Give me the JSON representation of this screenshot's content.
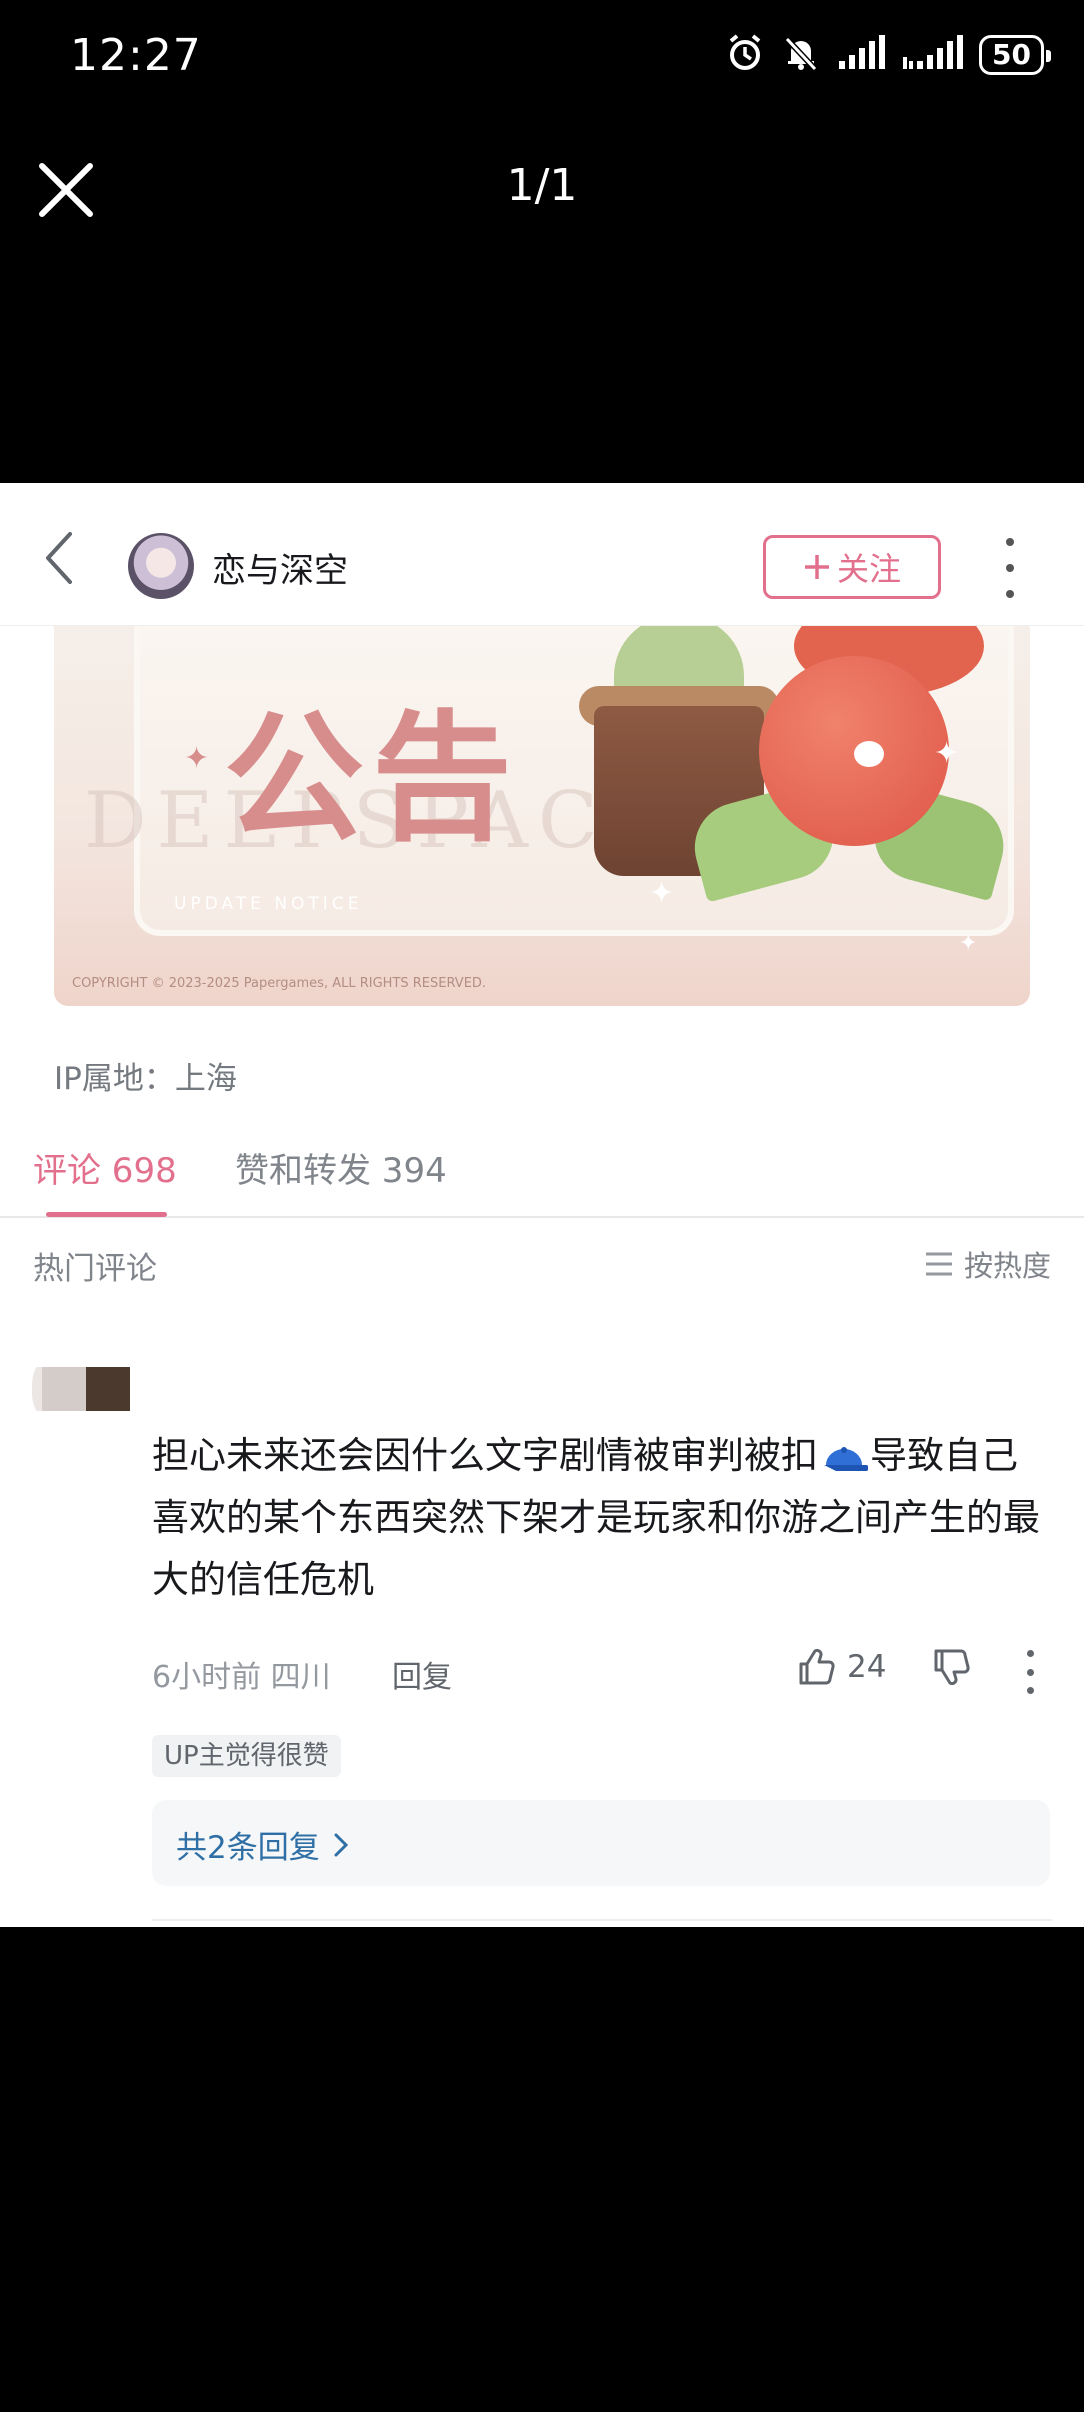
{
  "status_bar": {
    "time": "12:27",
    "battery": "50",
    "icons": [
      "alarm-icon",
      "bell-muted-icon",
      "signal-icon",
      "signal-icon"
    ]
  },
  "viewer": {
    "counter": "1/1",
    "close_icon": "close-icon"
  },
  "post_header": {
    "author_name": "恋与深空",
    "follow_label": "关注",
    "follow_icon": "plus-icon",
    "back_icon": "chevron-left-icon",
    "more_icon": "more-vertical-icon"
  },
  "banner": {
    "title": "公告",
    "watermark": "DEEPSPACE",
    "notice": "UPDATE NOTICE",
    "copyright": "COPYRIGHT © 2023-2025 Papergames, ALL RIGHTS RESERVED."
  },
  "post": {
    "ip_location": "IP属地：上海"
  },
  "tabs": [
    {
      "label": "评论 698",
      "active": true
    },
    {
      "label": "赞和转发 394",
      "active": false
    }
  ],
  "comments_section": {
    "hot_label": "热门评论",
    "sort_label": "按热度",
    "sort_icon": "list-icon"
  },
  "comment": {
    "text_part1": "担心未来还会因什么文字剧情被审判被扣",
    "emoji": "cap-emoji",
    "text_part2": "导致自己喜欢的某个东西突然下架才是玩家和你游之间产生的最大的信任危机",
    "time_location": "6小时前 四川",
    "reply_label": "回复",
    "like_count": "24",
    "up_badge": "UP主觉得很赞",
    "replies_label": "共2条回复"
  },
  "colors": {
    "accent": "#e2708d",
    "link": "#2f6fa5"
  }
}
